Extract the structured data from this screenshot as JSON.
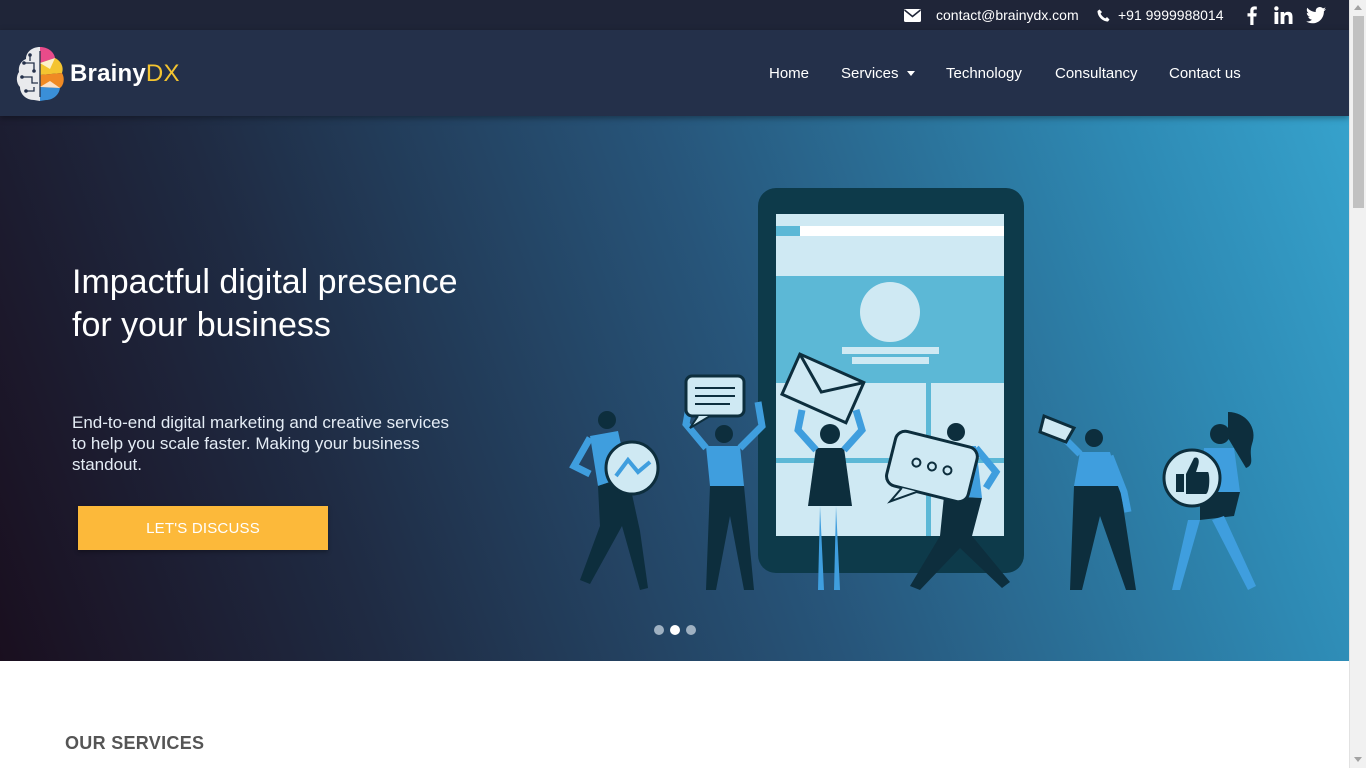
{
  "topbar": {
    "email": "contact@brainydx.com",
    "phone": "+91 9999988014",
    "email_icon": "envelope-icon",
    "phone_icon": "phone-icon",
    "social": [
      "facebook-icon",
      "linkedin-icon",
      "twitter-icon"
    ]
  },
  "brand": {
    "name_main": "Brainy",
    "name_accent": "DX",
    "accent_color": "#f4c430"
  },
  "nav": {
    "items": [
      {
        "label": "Home"
      },
      {
        "label": "Services",
        "dropdown": true
      },
      {
        "label": "Technology"
      },
      {
        "label": "Consultancy"
      },
      {
        "label": "Contact us"
      }
    ]
  },
  "hero": {
    "title": "Impactful digital presence for your business",
    "subtitle": "End-to-end digital marketing and creative services to help you scale faster. Making your business standout.",
    "cta_label": "LET'S DISCUSS",
    "cta_color": "#fcb93a",
    "carousel": {
      "slides": 3,
      "active": 2
    }
  },
  "services": {
    "heading": "OUR SERVICES"
  }
}
